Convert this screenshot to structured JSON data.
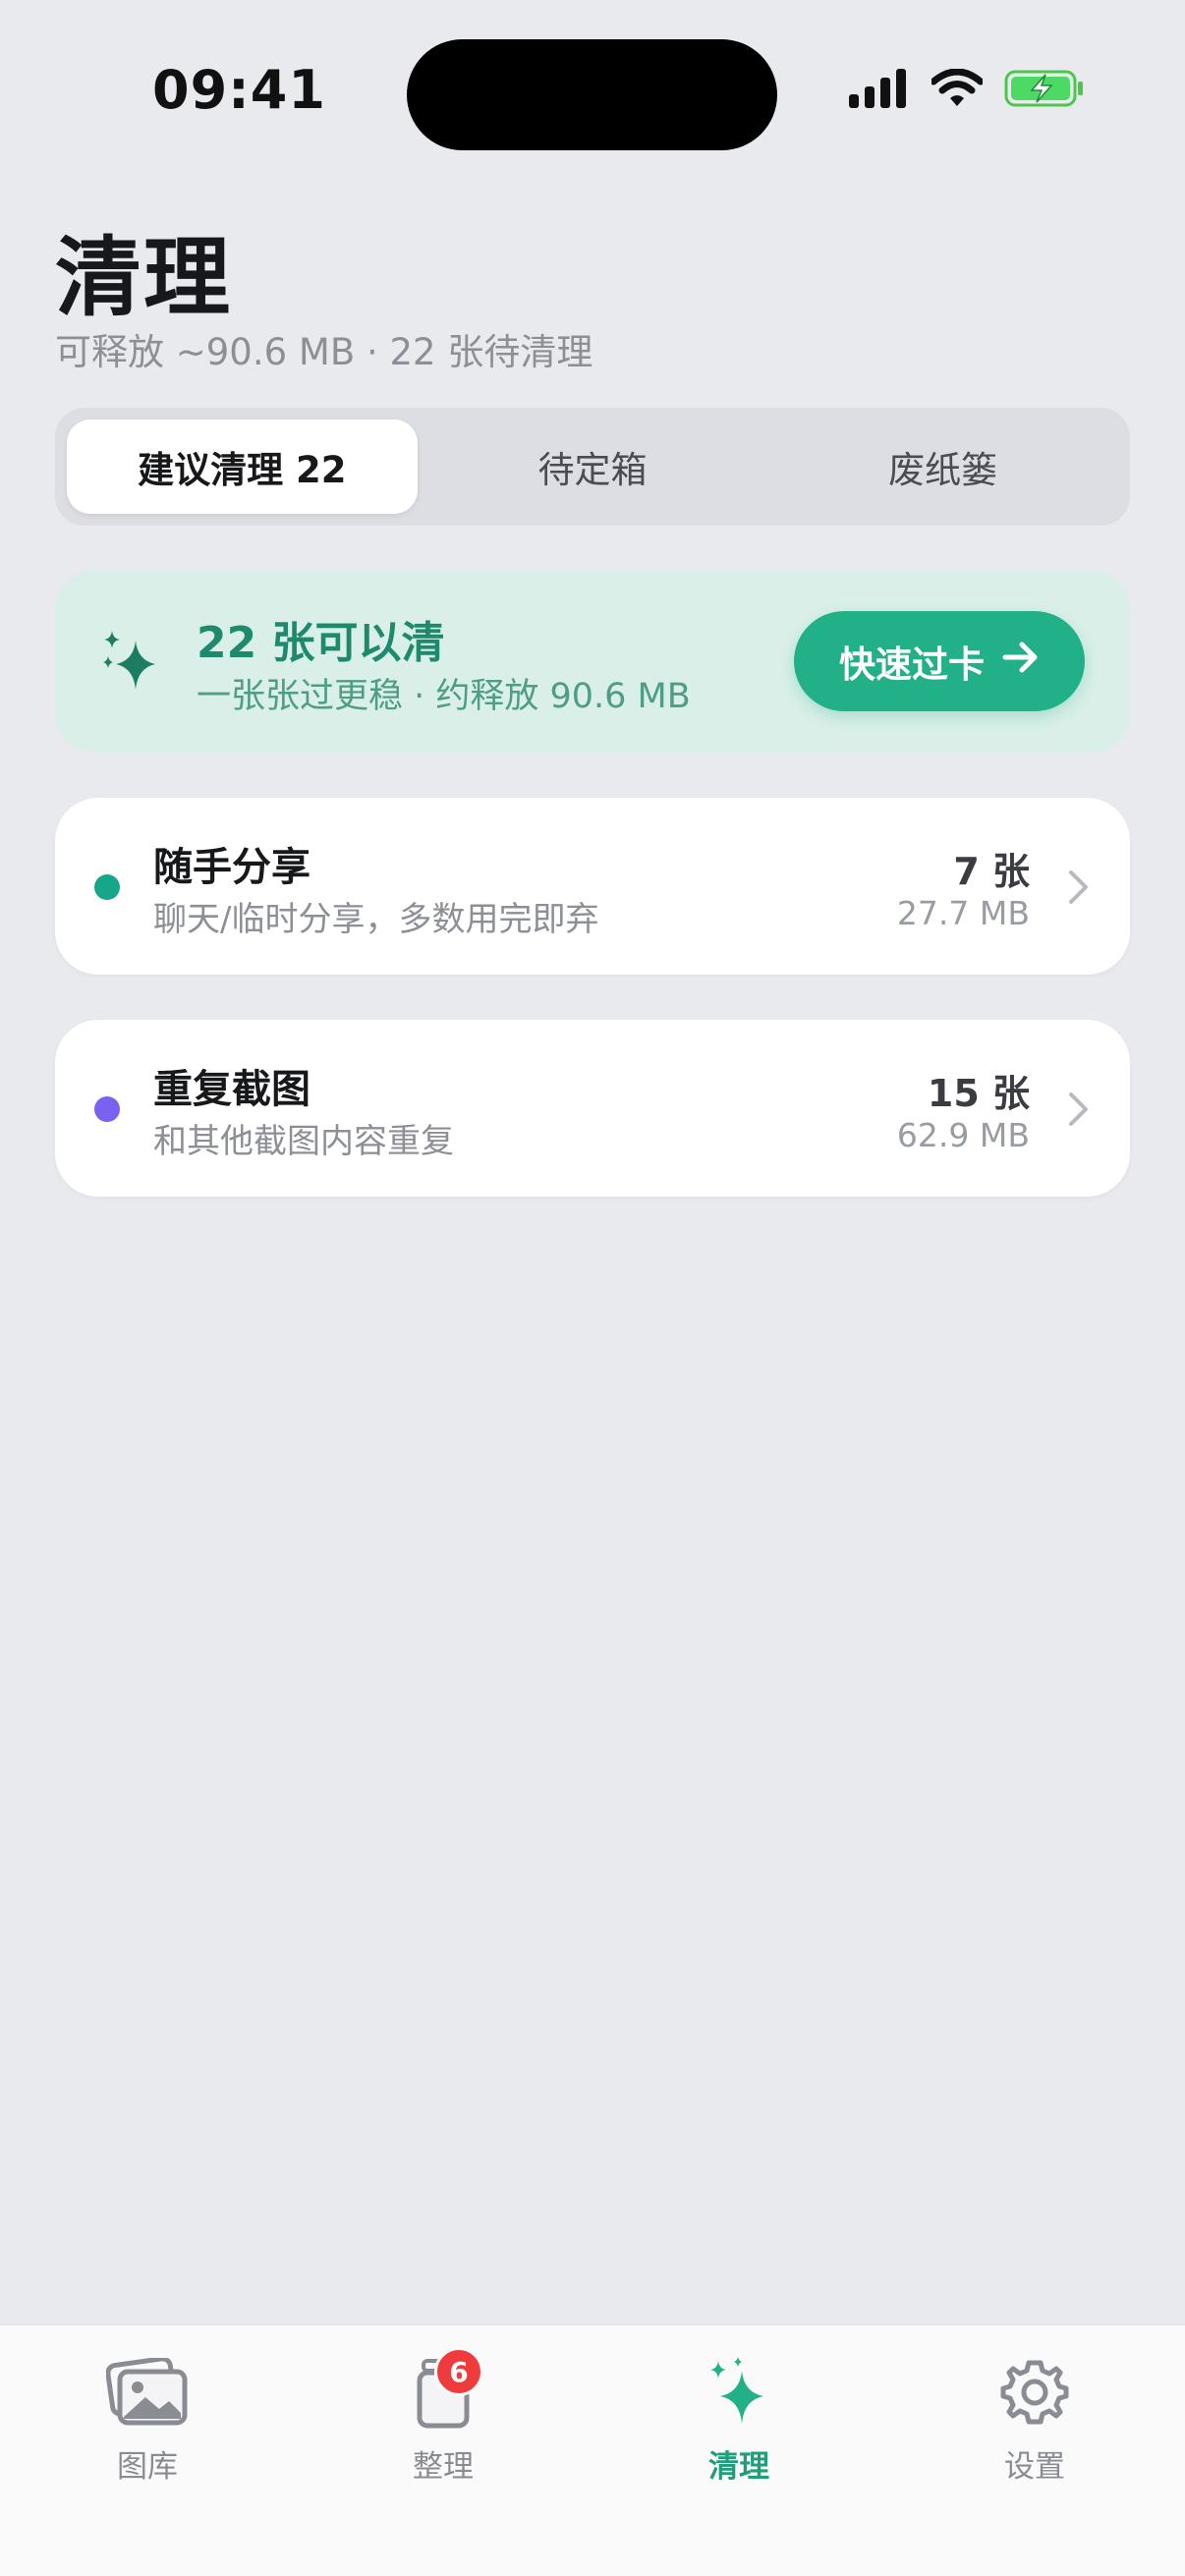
{
  "status": {
    "time": "09:41"
  },
  "header": {
    "title": "清理",
    "subtitle": "可释放 ~90.6 MB · 22 张待清理"
  },
  "segments": [
    {
      "label": "建议清理 22",
      "active": true
    },
    {
      "label": "待定箱",
      "active": false
    },
    {
      "label": "废纸篓",
      "active": false
    }
  ],
  "banner": {
    "title": "22 张可以清",
    "subtitle": "一张张过更稳 · 约释放 90.6 MB",
    "button_label": "快速过卡",
    "icon": "sparkle-icon",
    "accent": "#22b088"
  },
  "categories": [
    {
      "title": "随手分享",
      "desc": "聊天/临时分享，多数用完即弃",
      "count": "7 张",
      "size": "27.7 MB",
      "dot_color": "#16a68a"
    },
    {
      "title": "重复截图",
      "desc": "和其他截图内容重复",
      "count": "15 张",
      "size": "62.9 MB",
      "dot_color": "#7b61f0"
    }
  ],
  "tabbar": {
    "tabs": [
      {
        "label": "图库",
        "icon": "photos-icon",
        "active": false
      },
      {
        "label": "整理",
        "icon": "stack-icon",
        "active": false,
        "badge": "6"
      },
      {
        "label": "清理",
        "icon": "sparkle-icon",
        "active": true
      },
      {
        "label": "设置",
        "icon": "gear-icon",
        "active": false
      }
    ]
  }
}
